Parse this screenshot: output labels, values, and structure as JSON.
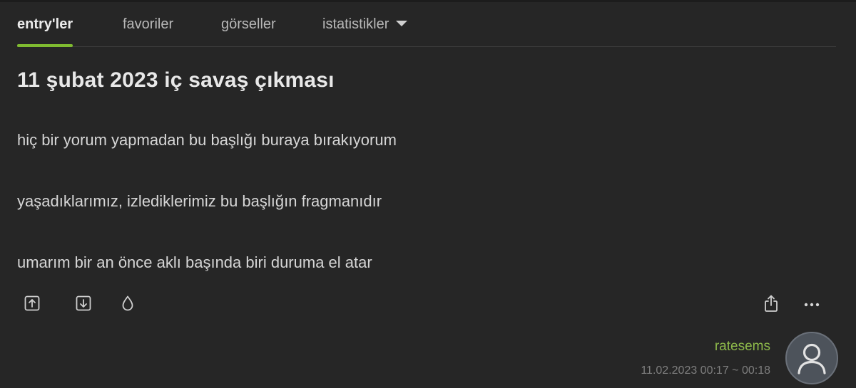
{
  "tabs": [
    {
      "label": "entry'ler",
      "active": true
    },
    {
      "label": "favoriler",
      "active": false
    },
    {
      "label": "görseller",
      "active": false
    },
    {
      "label": "istatistikler",
      "active": false,
      "has_dropdown": true
    }
  ],
  "title": "11 şubat 2023 iç savaş çıkması",
  "entry": {
    "paragraphs": [
      "hiç bir yorum yapmadan bu başlığı buraya bırakıyorum",
      "yaşadıklarımız, izlediklerimiz bu başlığın fragmanıdır",
      "umarım bir an önce aklı başında biri duruma el atar"
    ]
  },
  "actions": {
    "upvote_icon": "arrow-up-box-icon",
    "downvote_icon": "arrow-down-box-icon",
    "drop_icon": "drop-icon",
    "share_icon": "share-icon",
    "more_icon": "more-dots-icon"
  },
  "author": {
    "username": "ratesems",
    "timestamp": "11.02.2023 00:17 ~ 00:18"
  },
  "colors": {
    "background": "#262626",
    "accent": "#7fbb30",
    "username": "#8db94a",
    "text": "#d6d6d6",
    "muted": "#7e7e7e"
  }
}
